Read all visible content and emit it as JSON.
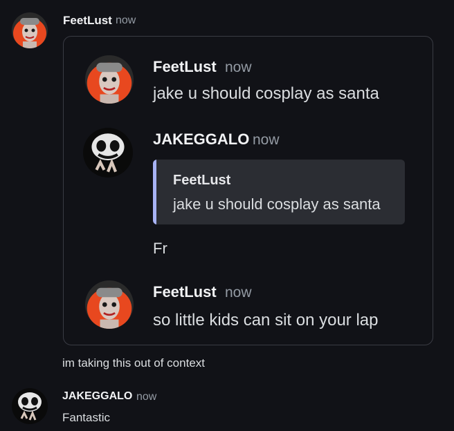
{
  "colors": {
    "background": "#111217",
    "embed_border": "#3a3c44",
    "quote_background": "#2b2d33",
    "quote_bar": "#a8b3f5",
    "username": "#f2f3f5",
    "timestamp": "#949ba4",
    "message_text": "#dbdee1"
  },
  "messages": [
    {
      "author": "FeetLust",
      "timestamp": "now",
      "avatar_icon": "clown-redhair-avatar"
    }
  ],
  "embed": {
    "messages": [
      {
        "author": "FeetLust",
        "timestamp": "now",
        "text": "jake u should cosplay as santa",
        "avatar_icon": "clown-redhair-avatar"
      },
      {
        "author": "JAKEGGALO",
        "timestamp": "now",
        "avatar_icon": "clown-face-avatar",
        "reply": {
          "author": "FeetLust",
          "text": "jake u should cosplay as santa"
        },
        "text": "Fr"
      },
      {
        "author": "FeetLust",
        "timestamp": "now",
        "text": "so little kids can sit on your lap",
        "avatar_icon": "clown-redhair-avatar"
      }
    ]
  },
  "caption": "im taking this out of context",
  "reply_message": {
    "author": "JAKEGGALO",
    "timestamp": "now",
    "text": "Fantastic",
    "avatar_icon": "clown-face-avatar"
  }
}
